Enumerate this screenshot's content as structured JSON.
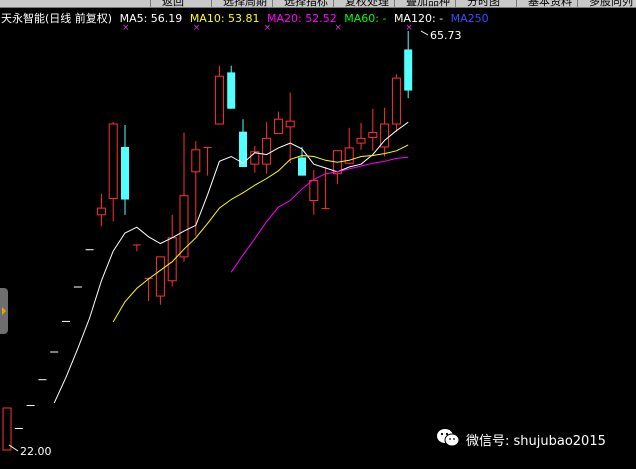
{
  "window": {
    "menu_tabs": [
      "返回",
      "选择周期",
      "选择指标",
      "复权处理",
      "叠加品种",
      "分时图",
      "基本资料",
      "多股同列"
    ]
  },
  "legend": {
    "title": "天永智能(日线 前复权)",
    "ma5_label": "MA5: 56.19",
    "ma10_label": "MA10: 53.81",
    "ma20_label": "MA20: 52.52",
    "ma60_label": "MA60: -",
    "ma120_label": "MA120: -",
    "ma250_label": "MA250"
  },
  "annotations": {
    "high_label": "65.73",
    "low_label": "22.00"
  },
  "watermark": {
    "text": "微信号: shujubao2015",
    "icon": "wechat-icon"
  },
  "colors": {
    "background": "#000000",
    "up_candle": "#ff3232",
    "down_candle": "#54ffff",
    "ma5": "#ffffff",
    "ma10": "#ffff00",
    "ma20": "#ff00ff",
    "ma250": "#0000ff"
  },
  "chart_data": {
    "type": "candlestick",
    "price_range": [
      22.0,
      65.73
    ],
    "candles": [
      {
        "open": 22.0,
        "high": 22.0,
        "low": 22.0,
        "close": 22.0
      },
      {
        "open": 24.2,
        "high": 24.2,
        "low": 24.2,
        "close": 24.2
      },
      {
        "open": 26.6,
        "high": 26.6,
        "low": 26.6,
        "close": 26.6
      },
      {
        "open": 29.3,
        "high": 29.3,
        "low": 29.3,
        "close": 29.3
      },
      {
        "open": 32.2,
        "high": 32.2,
        "low": 32.2,
        "close": 32.2
      },
      {
        "open": 35.4,
        "high": 35.4,
        "low": 35.4,
        "close": 35.4
      },
      {
        "open": 39.0,
        "high": 39.0,
        "low": 39.0,
        "close": 39.0
      },
      {
        "open": 42.9,
        "high": 42.9,
        "low": 42.9,
        "close": 42.9
      },
      {
        "open": 46.5,
        "high": 48.7,
        "low": 45.3,
        "close": 47.2
      },
      {
        "open": 48.2,
        "high": 56.2,
        "low": 45.8,
        "close": 56.0
      },
      {
        "open": 53.6,
        "high": 55.9,
        "low": 46.5,
        "close": 48.1
      },
      {
        "open": 43.4,
        "high": 43.4,
        "low": 42.7,
        "close": 43.4
      },
      {
        "open": 39.9,
        "high": 39.9,
        "low": 37.5,
        "close": 39.9
      },
      {
        "open": 38.0,
        "high": 42.1,
        "low": 37.1,
        "close": 42.1
      },
      {
        "open": 39.6,
        "high": 46.5,
        "low": 39.0,
        "close": 44.1
      },
      {
        "open": 42.1,
        "high": 55.1,
        "low": 41.6,
        "close": 48.5
      },
      {
        "open": 51.0,
        "high": 54.2,
        "low": 44.3,
        "close": 53.3
      },
      {
        "open": 53.6,
        "high": 53.6,
        "low": 50.6,
        "close": 53.6
      },
      {
        "open": 56.0,
        "high": 62.1,
        "low": 56.0,
        "close": 61.0
      },
      {
        "open": 61.4,
        "high": 62.1,
        "low": 57.6,
        "close": 57.6
      },
      {
        "open": 55.2,
        "high": 56.5,
        "low": 51.5,
        "close": 51.5
      },
      {
        "open": 51.8,
        "high": 53.7,
        "low": 50.9,
        "close": 53.1
      },
      {
        "open": 51.8,
        "high": 56.2,
        "low": 50.8,
        "close": 54.5
      },
      {
        "open": 55.0,
        "high": 57.3,
        "low": 55.0,
        "close": 56.5
      },
      {
        "open": 55.7,
        "high": 59.3,
        "low": 51.9,
        "close": 56.3
      },
      {
        "open": 52.5,
        "high": 53.6,
        "low": 50.6,
        "close": 50.6
      },
      {
        "open": 48.0,
        "high": 51.2,
        "low": 46.5,
        "close": 50.1
      },
      {
        "open": 47.2,
        "high": 51.5,
        "low": 47.2,
        "close": 47.2
      },
      {
        "open": 50.8,
        "high": 52.3,
        "low": 49.7,
        "close": 53.2
      },
      {
        "open": 51.9,
        "high": 55.6,
        "low": 51.8,
        "close": 53.5
      },
      {
        "open": 54.0,
        "high": 56.1,
        "low": 53.3,
        "close": 54.5
      },
      {
        "open": 54.6,
        "high": 57.6,
        "low": 53.2,
        "close": 55.1
      },
      {
        "open": 53.6,
        "high": 57.7,
        "low": 52.6,
        "close": 56.0
      },
      {
        "open": 56.0,
        "high": 61.2,
        "low": 55.2,
        "close": 60.8
      },
      {
        "open": 63.8,
        "high": 65.73,
        "low": 58.7,
        "close": 59.5
      }
    ],
    "ma5": [
      null,
      null,
      null,
      null,
      26.8,
      29.5,
      32.5,
      35.7,
      39.6,
      42.7,
      44.6,
      45.2,
      44.2,
      43.5,
      44.1,
      44.8,
      45.4,
      48.6,
      52.1,
      52.6,
      51.9,
      53.0,
      52.8,
      53.5,
      54.0,
      53.4,
      51.8,
      51.4,
      51.0,
      51.5,
      51.8,
      52.8,
      54.3,
      55.3,
      56.19
    ],
    "ma10": [
      null,
      null,
      null,
      null,
      null,
      null,
      null,
      null,
      null,
      35.3,
      37.4,
      38.8,
      39.8,
      40.7,
      41.6,
      42.9,
      44.1,
      45.6,
      47.2,
      48.1,
      48.8,
      49.6,
      50.3,
      51.1,
      52.3,
      52.7,
      52.6,
      52.2,
      52.0,
      52.2,
      52.6,
      52.7,
      52.9,
      53.2,
      53.81
    ],
    "ma20": [
      null,
      null,
      null,
      null,
      null,
      null,
      null,
      null,
      null,
      null,
      null,
      null,
      null,
      null,
      null,
      null,
      null,
      null,
      null,
      40.5,
      42.3,
      44.0,
      45.8,
      47.3,
      48.0,
      49.2,
      50.2,
      50.8,
      51.0,
      51.3,
      51.6,
      51.9,
      52.1,
      52.4,
      52.52
    ]
  }
}
